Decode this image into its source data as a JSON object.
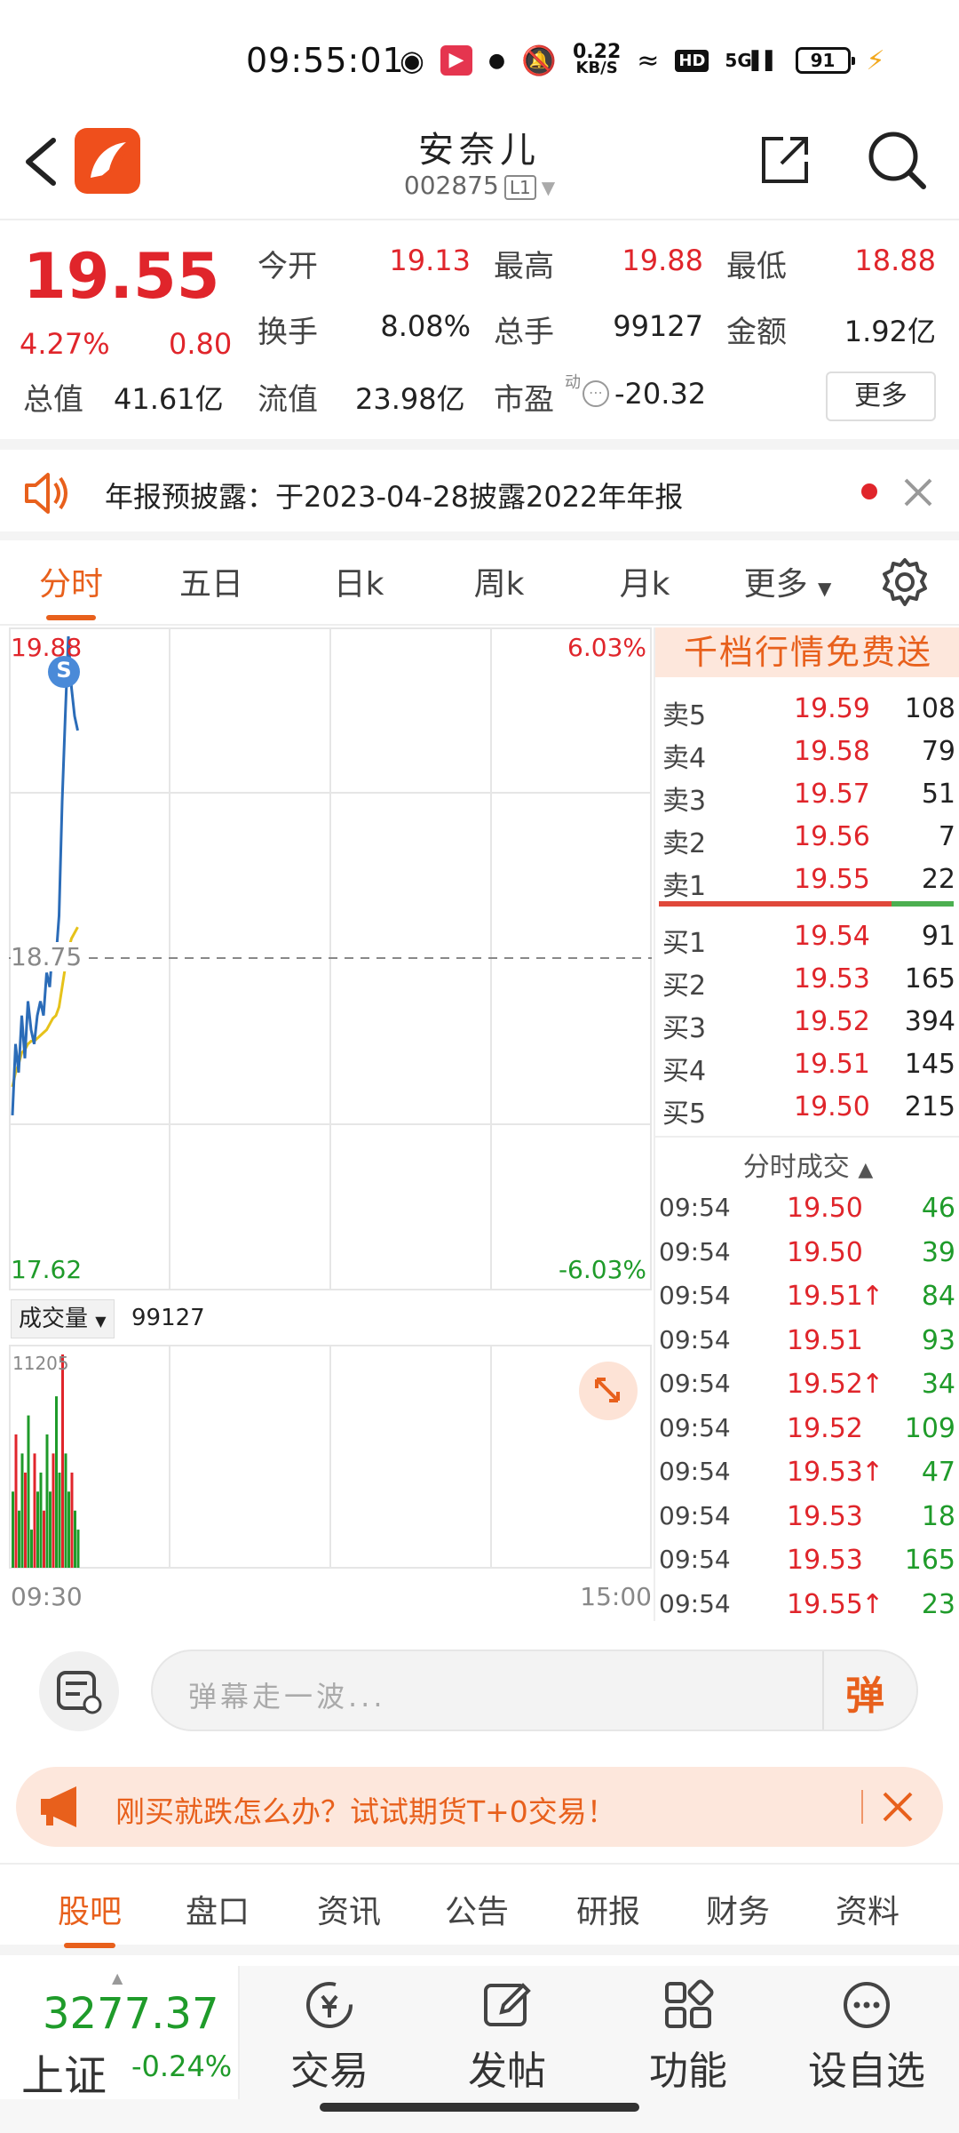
{
  "status": {
    "time": "09:55:01",
    "net_speed_top": "0.22",
    "net_speed_unit": "KB/S",
    "hd": "HD",
    "net": "5G",
    "battery": "91"
  },
  "header": {
    "name": "安奈儿",
    "code": "002875",
    "badge": "L1"
  },
  "quote": {
    "price": "19.55",
    "change_pct": "4.27%",
    "change": "0.80",
    "rows": [
      [
        {
          "label": "今开",
          "value": "19.13",
          "color": "red"
        },
        {
          "label": "最高",
          "value": "19.88",
          "color": "red"
        },
        {
          "label": "最低",
          "value": "18.88",
          "color": "red"
        }
      ],
      [
        {
          "label": "换手",
          "value": "8.08%",
          "color": "black"
        },
        {
          "label": "总手",
          "value": "99127",
          "color": "black"
        },
        {
          "label": "金额",
          "value": "1.92亿",
          "color": "black"
        }
      ]
    ],
    "total_label": "总值",
    "total_value": "41.61亿",
    "float_label": "流值",
    "float_value": "23.98亿",
    "pe_label": "市盈",
    "pe_sup": "动",
    "pe_value": "-20.32",
    "more": "更多"
  },
  "notice": {
    "text": "年报预披露：于2023-04-28披露2022年年报"
  },
  "chart_tabs": [
    "分时",
    "五日",
    "日k",
    "周k",
    "月k",
    "更多"
  ],
  "chart": {
    "top_price": "19.88",
    "top_pct": "6.03%",
    "mid_price": "18.75",
    "bottom_price": "17.62",
    "bottom_pct": "-6.03%",
    "signal": "S",
    "vol_label": "成交量",
    "vol_value": "99127",
    "vol_max": "11205",
    "t_start": "09:30",
    "t_end": "15:00"
  },
  "chart_data": {
    "type": "line",
    "ylim": [
      17.62,
      19.88
    ],
    "series": [
      {
        "values": [
          18.2,
          18.45,
          18.35,
          18.55,
          18.4,
          18.6,
          18.5,
          18.45,
          18.55,
          18.6,
          18.55,
          18.7,
          18.65,
          18.8,
          18.75,
          18.9,
          19.3,
          19.6,
          19.88,
          19.7,
          19.6,
          19.55
        ]
      },
      {
        "values": [
          18.3,
          18.35,
          18.38,
          18.42,
          18.43,
          18.45,
          18.46,
          18.46,
          18.47,
          18.48,
          18.49,
          18.5,
          18.52,
          18.54,
          18.55,
          18.58,
          18.65,
          18.72,
          18.78,
          18.82,
          18.84,
          18.86
        ]
      }
    ],
    "volume": [
      4,
      7,
      3,
      6,
      5,
      8,
      2,
      6,
      4,
      5,
      3,
      7,
      4,
      6,
      9,
      5,
      11.2,
      6,
      4,
      5,
      3,
      2
    ]
  },
  "book": {
    "banner": "千档行情免费送",
    "asks": [
      [
        "卖5",
        "19.59",
        "108"
      ],
      [
        "卖4",
        "19.58",
        "79"
      ],
      [
        "卖3",
        "19.57",
        "51"
      ],
      [
        "卖2",
        "19.56",
        "7"
      ],
      [
        "卖1",
        "19.55",
        "22"
      ]
    ],
    "bids": [
      [
        "买1",
        "19.54",
        "91"
      ],
      [
        "买2",
        "19.53",
        "165"
      ],
      [
        "买3",
        "19.52",
        "394"
      ],
      [
        "买4",
        "19.51",
        "145"
      ],
      [
        "买5",
        "19.50",
        "215"
      ]
    ],
    "trades_label": "分时成交",
    "trades": [
      [
        "09:54",
        "19.50",
        "",
        "46"
      ],
      [
        "09:54",
        "19.50",
        "",
        "39"
      ],
      [
        "09:54",
        "19.51",
        "↑",
        "84"
      ],
      [
        "09:54",
        "19.51",
        "",
        "93"
      ],
      [
        "09:54",
        "19.52",
        "↑",
        "34"
      ],
      [
        "09:54",
        "19.52",
        "",
        "109"
      ],
      [
        "09:54",
        "19.53",
        "↑",
        "47"
      ],
      [
        "09:54",
        "19.53",
        "",
        "18"
      ],
      [
        "09:54",
        "19.53",
        "",
        "165"
      ],
      [
        "09:54",
        "19.55",
        "↑",
        "23"
      ]
    ]
  },
  "comment": {
    "placeholder": "弹幕走一波...",
    "danmu": "弹"
  },
  "ad": {
    "text": "刚买就跌怎么办？试试期货T+0交易！"
  },
  "bottom_tabs": [
    "股吧",
    "盘口",
    "资讯",
    "公告",
    "研报",
    "财务",
    "资料"
  ],
  "index": {
    "value": "3277.37",
    "name": "上证",
    "pct": "-0.24%"
  },
  "nav": [
    "交易",
    "发帖",
    "功能",
    "设自选"
  ],
  "colors": {
    "accent": "#e8601c",
    "up": "#e0252b",
    "down": "#1f9b2a"
  }
}
